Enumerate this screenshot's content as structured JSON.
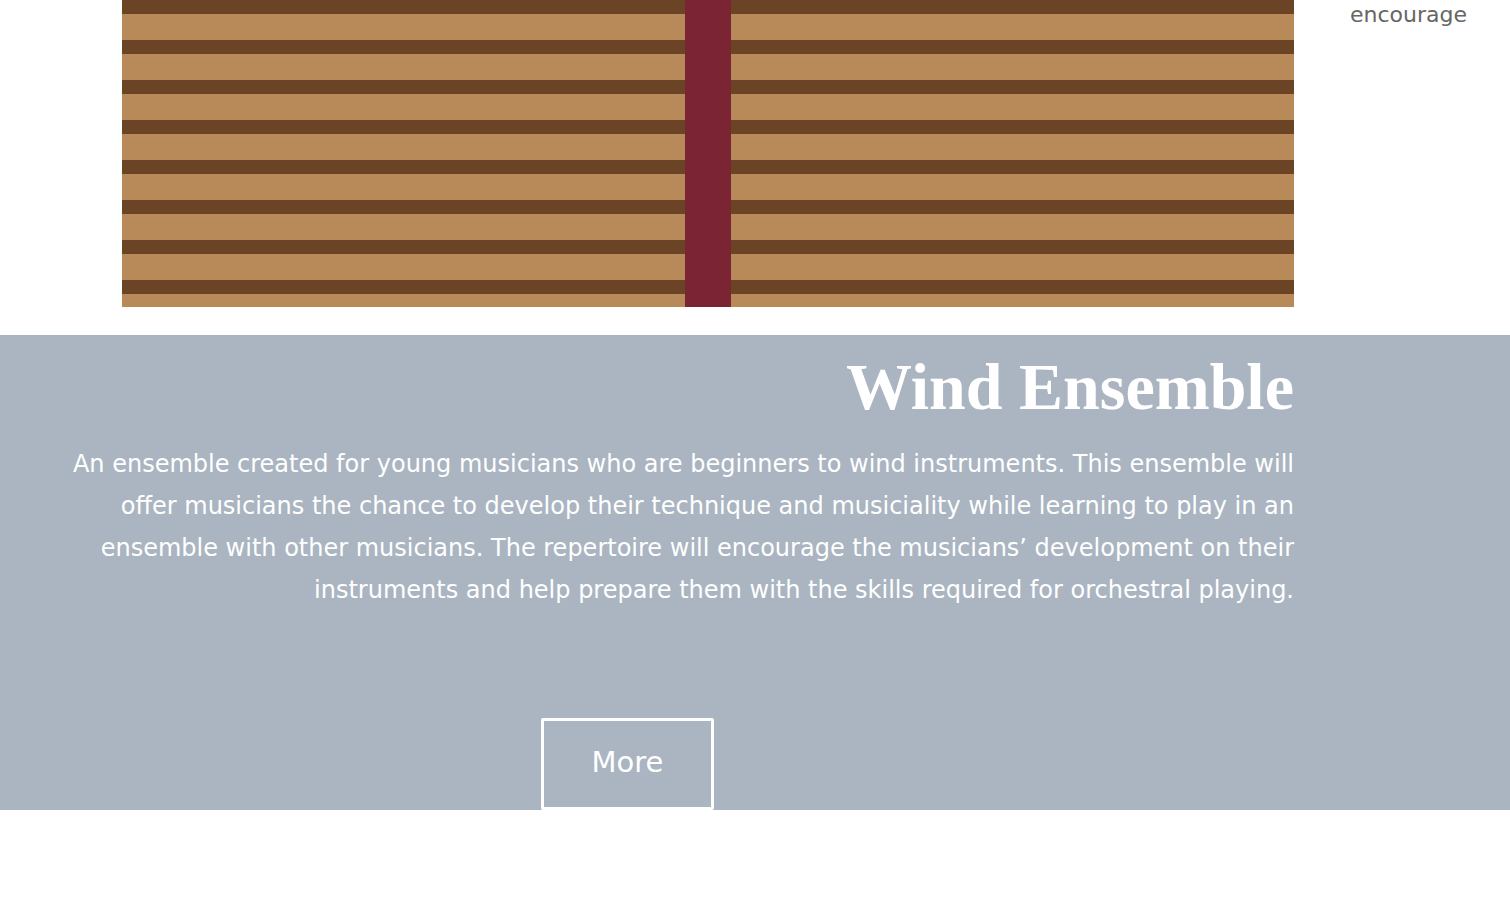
{
  "sidebar_snippet": "encourage",
  "ensemble": {
    "title": "Wind Ensemble",
    "description": "An ensemble created for young musicians who are beginners to wind instruments. This ensemble will offer musicians the chance to develop their technique and musiciality while learning to play in an ensemble with other musicians. The repertoire will encourage the musicians’ development on their instruments and help prepare them with the skills required for orchestral playing.",
    "button": "More"
  }
}
